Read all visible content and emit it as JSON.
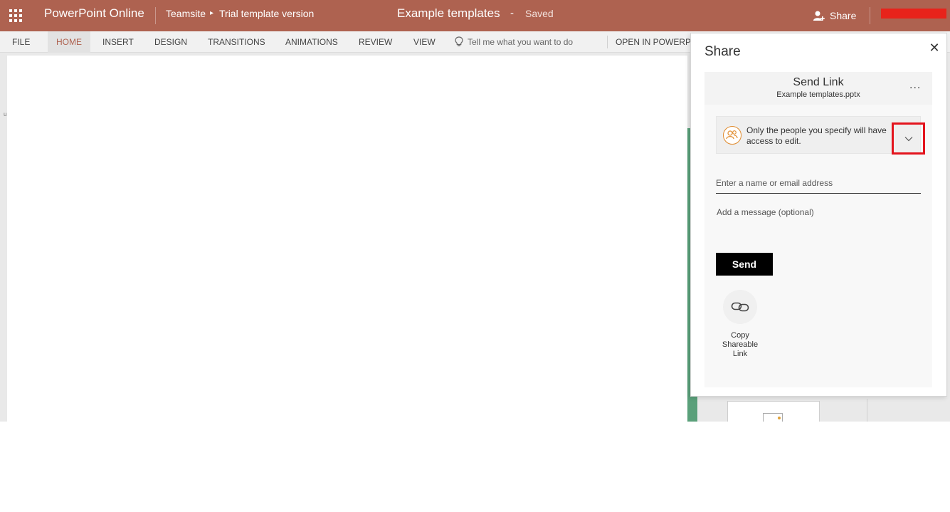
{
  "topbar": {
    "app_title": "PowerPoint Online",
    "breadcrumb_site": "Teamsite",
    "breadcrumb_folder": "Trial template version",
    "document_title": "Example templates",
    "separator": "-",
    "save_status": "Saved",
    "share_label": "Share",
    "accent_color": "#ae6250",
    "user_name_redacted_color": "#e8231b"
  },
  "ribbon": {
    "tabs": [
      "FILE",
      "HOME",
      "INSERT",
      "DESIGN",
      "TRANSITIONS",
      "ANIMATIONS",
      "REVIEW",
      "VIEW"
    ],
    "active_tab": "HOME",
    "tell_me": "Tell me what you want to do",
    "open_in": "OPEN IN POWERP"
  },
  "share_panel": {
    "title": "Share",
    "send_link_title": "Send Link",
    "file_name": "Example templates.pptx",
    "more_label": "...",
    "permission_text": "Only the people you specify will have access to edit.",
    "name_placeholder": "Enter a name or email address",
    "message_placeholder": "Add a message (optional)",
    "send_label": "Send",
    "copy_link_label": "Copy Shareable Link",
    "highlight_color": "#e3141d"
  }
}
